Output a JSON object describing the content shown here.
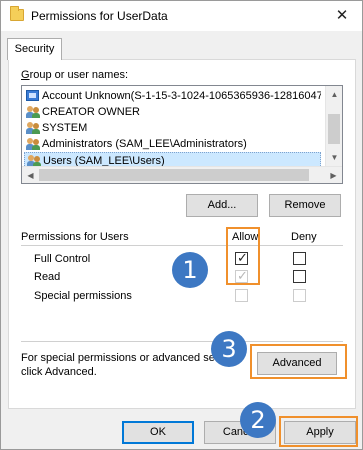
{
  "window": {
    "title": "Permissions for UserData",
    "close_glyph": "✕"
  },
  "tab": {
    "label": "Security"
  },
  "group_label": "Group or user names:",
  "group_label_u": "G",
  "users": [
    {
      "name": "Account Unknown(S-1-15-3-1024-1065365936-12816047…",
      "icon": "unknown-account-icon"
    },
    {
      "name": "CREATOR OWNER",
      "icon": "users-group-icon"
    },
    {
      "name": "SYSTEM",
      "icon": "users-group-icon"
    },
    {
      "name": "Administrators (SAM_LEE\\Administrators)",
      "icon": "users-group-icon"
    },
    {
      "name": "Users (SAM_LEE\\Users)",
      "icon": "users-group-icon",
      "selected": true
    }
  ],
  "buttons": {
    "add": "Add...",
    "remove": "Remove",
    "advanced": "Advanced",
    "ok": "OK",
    "cancel": "Cancel",
    "apply": "Apply"
  },
  "permissions": {
    "label": "Permissions for Users",
    "allow_header": "Allow",
    "deny_header": "Deny",
    "rows": [
      {
        "name": "Full Control",
        "allow": "checked",
        "deny": "unchecked"
      },
      {
        "name": "Read",
        "allow": "checked-disabled",
        "deny": "unchecked"
      },
      {
        "name": "Special permissions",
        "allow": "disabled",
        "deny": "disabled"
      }
    ]
  },
  "advanced_text_line1": "For special permissions or advanced se",
  "advanced_text_line2": "click Advanced.",
  "annotations": [
    "1",
    "2",
    "3"
  ],
  "colors": {
    "highlight": "#f0902c",
    "badge": "#3d78c3",
    "selection": "#cce8ff"
  }
}
